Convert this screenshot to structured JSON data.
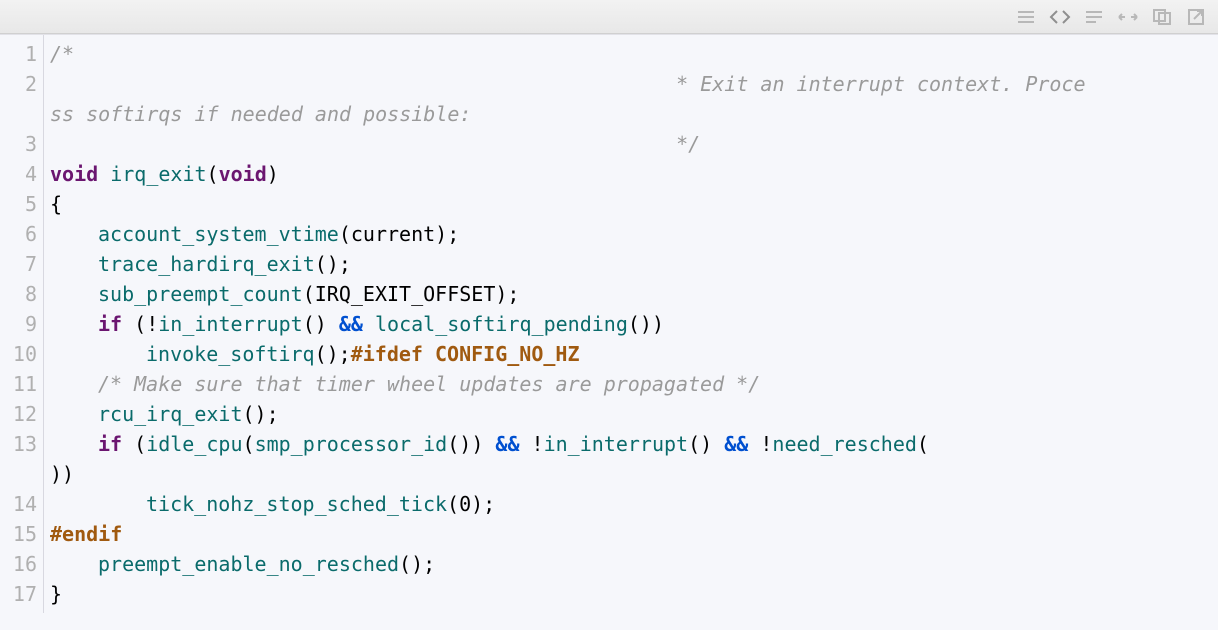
{
  "toolbar": {
    "buttons": [
      {
        "name": "menu-icon",
        "title": "Menu"
      },
      {
        "name": "code-icon",
        "title": "Code",
        "selected": true
      },
      {
        "name": "list-icon",
        "title": "List"
      },
      {
        "name": "expand-icon",
        "title": "Expand"
      },
      {
        "name": "copy-icon",
        "title": "Copy"
      },
      {
        "name": "popout-icon",
        "title": "Open in new window"
      }
    ]
  },
  "gutter": [
    "1",
    "2",
    "",
    "3",
    "4",
    "5",
    "6",
    "7",
    "8",
    "9",
    "10",
    "11",
    "12",
    "13",
    "",
    "14",
    "15",
    "16",
    "17"
  ],
  "code": {
    "lines": [
      {
        "type": "comment",
        "text": "/*"
      },
      {
        "type": "comment_wrap",
        "prefix": "                                                    ",
        "lead": "* ",
        "text": "Exit an interrupt context. Process softirqs if needed and possible:"
      },
      {
        "type": "comment",
        "text": "                                                    */"
      },
      {
        "type": "sig",
        "kw1": "void",
        "sp1": " ",
        "fn": "irq_exit",
        "open": "(",
        "kw2": "void",
        "close": ")"
      },
      {
        "type": "punc",
        "text": "{"
      },
      {
        "type": "call1",
        "indent": 1,
        "fn": "account_system_vtime",
        "args": [
          {
            "ident": "current"
          }
        ],
        "tail": ";"
      },
      {
        "type": "call1",
        "indent": 1,
        "fn": "trace_hardirq_exit",
        "args": [],
        "tail": ";"
      },
      {
        "type": "call1",
        "indent": 1,
        "fn": "sub_preempt_count",
        "args": [
          {
            "upper": "IRQ_EXIT_OFFSET"
          }
        ],
        "tail": ";"
      },
      {
        "type": "if1",
        "indent": 1,
        "kw": "if",
        "open": " (",
        "bang1": "!",
        "fn1": "in_interrupt",
        "par1": "()",
        "sp1": " ",
        "op": "&&",
        "sp2": " ",
        "fn2": "local_softirq_pending",
        "par2": "()",
        "close": ")"
      },
      {
        "type": "call_plus",
        "indent": 2,
        "fn": "invoke_softirq",
        "par": "()",
        "semi": ";",
        "pre": "#ifdef",
        "sp": " ",
        "macro": "CONFIG_NO_HZ"
      },
      {
        "type": "comment_ind",
        "indent": 1,
        "text": "/* Make sure that timer wheel updates are propagated */"
      },
      {
        "type": "call1",
        "indent": 1,
        "fn": "rcu_irq_exit",
        "args": [],
        "tail": ";"
      },
      {
        "type": "if2",
        "indent": 1,
        "kw": "if",
        "open": " (",
        "fn1": "idle_cpu",
        "open1": "(",
        "fn1a": "smp_processor_id",
        "par1a": "()",
        "close1": ")",
        "sp1": " ",
        "op1": "&&",
        "sp2": " ",
        "bang2": "!",
        "fn2": "in_interrupt",
        "par2": "()",
        "sp3": " ",
        "op2": "&&",
        "sp4": " ",
        "bang3": "!",
        "fn3": "need_resched",
        "open3": "(",
        "wrap_close": "))"
      },
      {
        "type": "call_arg",
        "indent": 2,
        "fn": "tick_nohz_stop_sched_tick",
        "open": "(",
        "arg": "0",
        "close": ")",
        "semi": ";"
      },
      {
        "type": "preproc",
        "text": "#endif"
      },
      {
        "type": "call1",
        "indent": 1,
        "fn": "preempt_enable_no_resched",
        "args": [],
        "tail": ";"
      },
      {
        "type": "punc",
        "text": "}"
      }
    ]
  }
}
